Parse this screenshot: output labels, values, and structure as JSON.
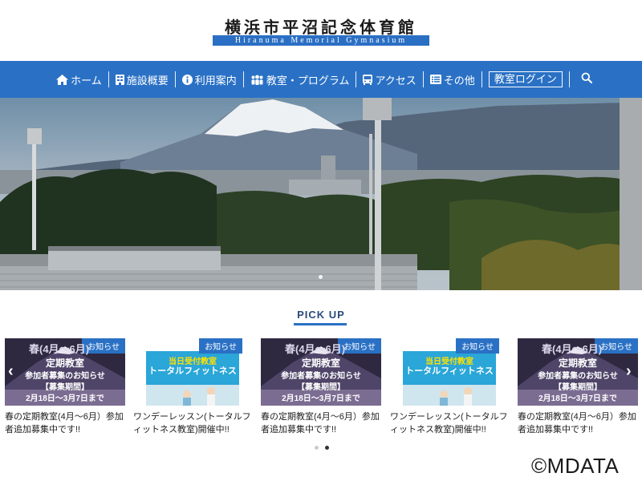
{
  "header": {
    "title": "横浜市平沼記念体育館",
    "subtitle": "Hiranuma Memorial Gymnasium"
  },
  "nav": {
    "items": [
      {
        "label": "ホーム",
        "icon": "home-icon"
      },
      {
        "label": "施設概要",
        "icon": "building-icon"
      },
      {
        "label": "利用案内",
        "icon": "info-icon"
      },
      {
        "label": "教室・プログラム",
        "icon": "people-icon"
      },
      {
        "label": "アクセス",
        "icon": "bus-icon"
      },
      {
        "label": "その他",
        "icon": "list-icon"
      }
    ],
    "login_label": "教室ログイン",
    "search_icon": "search-icon"
  },
  "pickup": {
    "title": "PICK UP",
    "cards": [
      {
        "badge": "お知らせ",
        "kind": "spring",
        "lines": [
          "春(4月～6月)",
          "定期教室",
          "参加者募集のお知らせ",
          "【募集期間】",
          "2月18日～3月7日まで"
        ],
        "caption": "春の定期教室(4月～6月）参加者追加募集中です!!"
      },
      {
        "badge": "お知らせ",
        "kind": "fitness",
        "lines": [
          "当日受付教室",
          "トータルフィットネス"
        ],
        "caption": "ワンデーレッスン(トータルフィットネス教室)開催中!!"
      },
      {
        "badge": "お知らせ",
        "kind": "spring",
        "lines": [
          "春(4月～6月)",
          "定期教室",
          "参加者募集のお知らせ",
          "【募集期間】",
          "2月18日～3月7日まで"
        ],
        "caption": "春の定期教室(4月～6月）参加者追加募集中です!!"
      },
      {
        "badge": "お知らせ",
        "kind": "fitness",
        "lines": [
          "当日受付教室",
          "トータルフィットネス"
        ],
        "caption": "ワンデーレッスン(トータルフィットネス教室)開催中!!"
      },
      {
        "badge": "お知らせ",
        "kind": "spring",
        "lines": [
          "春(4月～6月)",
          "定期教室",
          "参加者募集のお知らせ",
          "【募集期間】",
          "2月18日～3月7日まで"
        ],
        "caption": "春の定期教室(4月～6月）参加者追加募集中です!!"
      }
    ],
    "prev_arrow": "‹",
    "next_arrow": "›"
  },
  "copyright": "©MDATA",
  "colors": {
    "nav_bg": "#2a71c5",
    "accent": "#2a71c5",
    "badge_bg": "#2a71c5",
    "spring_card_bg": "#3a2f4a",
    "fitness_card_bg": "#2aa6d8"
  }
}
